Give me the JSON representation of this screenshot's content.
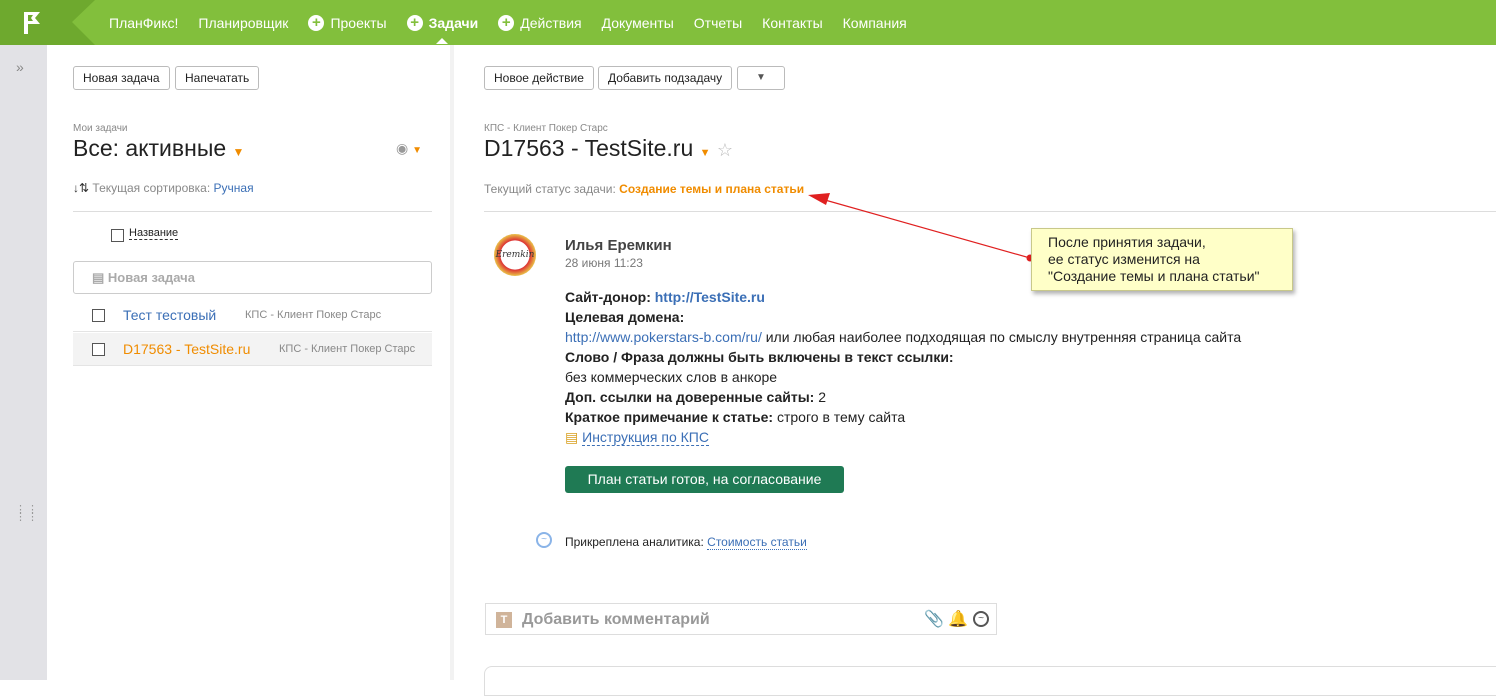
{
  "nav": {
    "items": [
      {
        "label": "ПланФикс!",
        "plus": false
      },
      {
        "label": "Планировщик",
        "plus": false
      },
      {
        "label": "Проекты",
        "plus": true
      },
      {
        "label": "Задачи",
        "plus": true,
        "active": true
      },
      {
        "label": "Действия",
        "plus": true
      },
      {
        "label": "Документы",
        "plus": false
      },
      {
        "label": "Отчеты",
        "plus": false
      },
      {
        "label": "Контакты",
        "plus": false
      },
      {
        "label": "Компания",
        "plus": false
      }
    ]
  },
  "left": {
    "new_task": "Новая задача",
    "print": "Напечатать",
    "section": "Мои задачи",
    "filter": "Все: активные",
    "sort_label": "Текущая сортировка:",
    "sort_value": "Ручная",
    "col_name": "Название",
    "new_task_placeholder": "Новая задача",
    "tasks": [
      {
        "title": "Тест тестовый",
        "project": "КПС - Клиент Покер Старс"
      },
      {
        "title": "D17563 - TestSite.ru",
        "project": "КПС - Клиент Покер Старс"
      }
    ]
  },
  "right": {
    "new_action": "Новое действие",
    "add_subtask": "Добавить подзадачу",
    "more": "▼",
    "project": "КПС - Клиент Покер Старс",
    "title": "D17563 - TestSite.ru",
    "status_label": "Текущий статус задачи:",
    "status_value": "Создание темы и плана статьи",
    "author": "Илья Еремкин",
    "avatar_text": "Eremkin",
    "date": "28 июня 11:23",
    "donor_label": "Сайт-донор:",
    "donor_link": "http://TestSite.ru",
    "target_label": "Целевая домена:",
    "target_link": "http://www.pokerstars-b.com/ru/",
    "target_rest": " или любая наиболее подходящая по смыслу внутренняя страница сайта",
    "phrase_label": "Слово / Фраза должны быть включены в текст ссылки:",
    "phrase_value": "без коммерческих слов в анкоре",
    "extra_label": "Доп. ссылки на доверенные сайты:",
    "extra_value": " 2",
    "note_label": "Краткое примечание к статье:",
    "note_value": " строго в тему сайта",
    "instruction": "Инструкция по КПС",
    "action_button": "План статьи готов, на согласование",
    "analytics_label": "Прикреплена аналитика:",
    "analytics_link": "Стоимость статьи",
    "comment_placeholder": "Добавить комментарий"
  },
  "callout": {
    "line1": "После принятия задачи,",
    "line2": "ее статус изменится на",
    "line3": "\"Создание темы и плана статьи\""
  }
}
